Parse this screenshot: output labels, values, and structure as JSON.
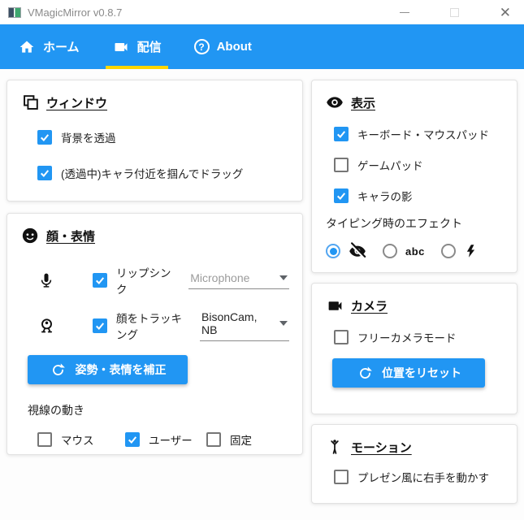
{
  "window": {
    "title": "VMagicMirror v0.8.7",
    "controls": {
      "minimize": "minimize-icon",
      "maximize": "maximize-icon",
      "close": "close-icon"
    }
  },
  "nav": {
    "tabs": [
      {
        "label": "ホーム",
        "icon": "home-icon",
        "active": false
      },
      {
        "label": "配信",
        "icon": "video-camera-icon",
        "active": true
      },
      {
        "label": "About",
        "icon": "help-icon",
        "active": false
      }
    ]
  },
  "colors": {
    "accent_blue": "#2196F3",
    "active_tab_underline": "#FFD600"
  },
  "left": {
    "window_card": {
      "title": "ウィンドウ",
      "icon": "windows-overlap-icon",
      "transparent_bg": {
        "label": "背景を透過",
        "checked": true
      },
      "drag_char": {
        "label": "(透過中)キャラ付近を掴んでドラッグ",
        "checked": true
      }
    },
    "face_card": {
      "title": "顔・表情",
      "icon": "face-icon",
      "lip_sync": {
        "icon": "microphone-icon",
        "label": "リップシンク",
        "checked": true,
        "device": "Microphone"
      },
      "face_tracking": {
        "icon": "webcam-icon",
        "label": "顔をトラッキング",
        "checked": true,
        "device": "BisonCam, NB"
      },
      "calibrate_button": {
        "icon": "refresh-icon",
        "label": "姿勢・表情を補正"
      },
      "gaze": {
        "label": "視線の動き",
        "mouse": {
          "label": "マウス",
          "checked": false
        },
        "user": {
          "label": "ユーザー",
          "checked": true
        },
        "fixed": {
          "label": "固定",
          "checked": false
        }
      }
    }
  },
  "right": {
    "display_card": {
      "title": "表示",
      "icon": "eye-icon",
      "keyboard_mousepad": {
        "label": "キーボード・マウスパッド",
        "checked": true
      },
      "gamepad": {
        "label": "ゲームパッド",
        "checked": false
      },
      "char_shadow": {
        "label": "キャラの影",
        "checked": true
      },
      "typing_effect": {
        "label": "タイピング時のエフェクト",
        "none": {
          "icon": "eye-off-icon",
          "selected": true
        },
        "abc": {
          "icon": "abc-text",
          "text": "abc",
          "selected": false
        },
        "lightning": {
          "icon": "lightning-icon",
          "selected": false
        }
      }
    },
    "camera_card": {
      "title": "カメラ",
      "icon": "video-camera-icon",
      "free_camera": {
        "label": "フリーカメラモード",
        "checked": false
      },
      "reset_button": {
        "icon": "refresh-icon",
        "label": "位置をリセット"
      }
    },
    "motion_card": {
      "title": "モーション",
      "icon": "person-arms-up-icon",
      "presentation": {
        "label": "プレゼン風に右手を動かす",
        "checked": false
      }
    }
  }
}
